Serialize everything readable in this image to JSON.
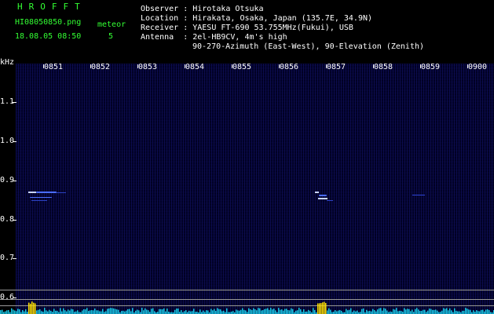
{
  "header": {
    "brand": "HROFFT",
    "filename": "HI08050850.png",
    "timestamp": "18.08.05 08:50",
    "meteor_label": "meteor",
    "meteor_count": "5",
    "info": [
      {
        "key": "Observer",
        "sep": " : ",
        "value": "Hirotaka Otsuka"
      },
      {
        "key": "Location",
        "sep": " : ",
        "value": "Hirakata, Osaka, Japan (135.7E, 34.9N)"
      },
      {
        "key": "Receiver",
        "sep": " : ",
        "value": "YAESU FT-690 53.755MHz(Fukui), USB"
      },
      {
        "key": "Antenna ",
        "sep": " : ",
        "value": "2el-HB9CV, 4m's high"
      }
    ],
    "antenna_line2": "90-270-Azimuth (East-West), 90-Elevation (Zenith)"
  },
  "axis": {
    "y_unit": "kHz",
    "y_ticks": [
      "1.1",
      "1.0",
      "0.9",
      "0.8",
      "0.7",
      "0.6"
    ],
    "x_ticks": [
      "0851",
      "0852",
      "0853",
      "0854",
      "0855",
      "0856",
      "0857",
      "0858",
      "0859",
      "0900"
    ]
  },
  "colors": {
    "brand": "#33ff33",
    "text": "#ffffff",
    "echo": "#4a6cff",
    "meter_base": "#19c8e6",
    "meter_peak": "#ffe000"
  }
}
